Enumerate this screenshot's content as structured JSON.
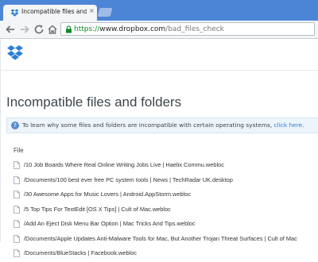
{
  "browser": {
    "tab_title": "Incompatible files and fold",
    "tab_close": "×",
    "url_scheme": "https://",
    "url_host": "www.dropbox.com",
    "url_path": "/bad_files_check"
  },
  "page": {
    "title": "Incompatible files and folders",
    "notice_text": "To learn why some files and folders are incompatible with certain operating systems, ",
    "notice_link": "click here.",
    "notice_icon": "info-icon",
    "column_header": "File"
  },
  "files": [
    "/10 Job Boards Where Real Online Writing Jobs Live | Haelix Commu.webloc",
    "/Documents/100 best ever free PC system tools | News | TechRadar UK.desktop",
    "/30 Awesome Apps for Music Lovers | Android.AppStorm.webloc",
    "/5 Top Tips For TextEdit [OS X Tips] | Cult of Mac.webloc",
    "/Add An Eject Disk Menu Bar Option | Mac Tricks And Tips.webloc",
    "/Documents/Apple Updates Anti-Malware Tools for Mac, But Another Trojan Threat Surfaces | Cult of Mac",
    "/Documents/BlueStacks | Facebook.webloc"
  ],
  "colors": {
    "tabstrip": "#4d85d6",
    "dropbox_blue": "#2d7fd6",
    "link": "#2b7bd6",
    "secure_green": "#0b8a2a"
  }
}
